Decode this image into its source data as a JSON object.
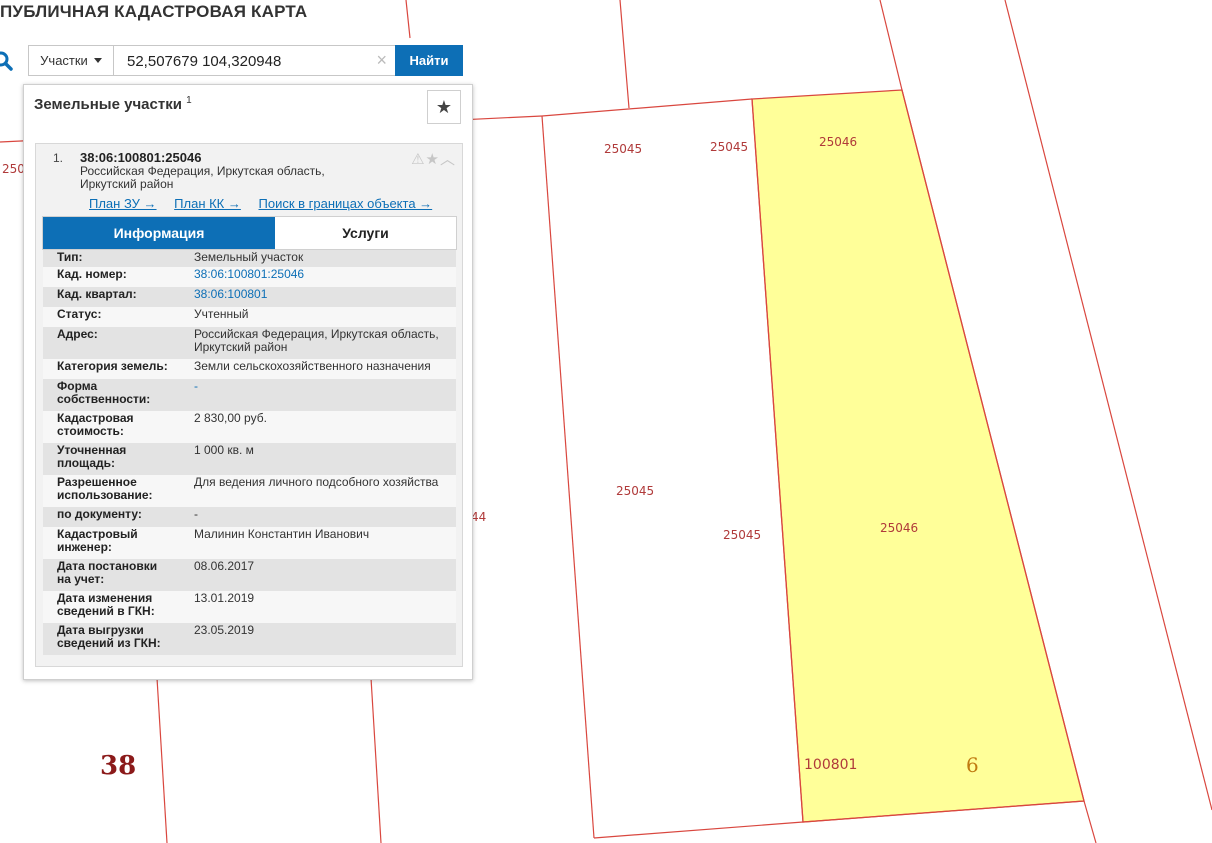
{
  "app_title": "ПУБЛИЧНАЯ КАДАСТРОВАЯ КАРТА",
  "search": {
    "type_label": "Участки",
    "query": "52,507679 104,320948",
    "clear_glyph": "×",
    "find_label": "Найти"
  },
  "panel": {
    "title": "Земельные участки",
    "count": "1",
    "favorite_glyph": "★"
  },
  "result": {
    "index": "1.",
    "cad_number": "38:06:100801:25046",
    "address_line1": "Российская Федерация, Иркутская область,",
    "address_line2": "Иркутский район",
    "links": {
      "plan_zu": "План ЗУ →",
      "plan_kk": "План КК →",
      "search_bounds": "Поиск в границах объекта →"
    },
    "tabs": {
      "info": "Информация",
      "services": "Услуги"
    },
    "details": [
      {
        "key": "Тип:",
        "value": "Земельный участок"
      },
      {
        "key": "Кад. номер:",
        "value": "38:06:100801:25046"
      },
      {
        "key": "Кад. квартал:",
        "value": "38:06:100801"
      },
      {
        "key": "Статус:",
        "value": "Учтенный"
      },
      {
        "key": "Адрес:",
        "value": "Российская Федерация, Иркутская область, Иркутский район"
      },
      {
        "key": "Категория земель:",
        "value": "Земли сельскохозяйственного назначения"
      },
      {
        "key": "Форма собственности:",
        "value": "-"
      },
      {
        "key": "Кадастровая стоимость:",
        "value": "2 830,00 руб."
      },
      {
        "key": "Уточненная площадь:",
        "value": "1 000 кв. м"
      },
      {
        "key": "Разрешенное использование:",
        "value": "Для ведения личного подсобного хозяйства"
      },
      {
        "key": "по документу:",
        "value": "-"
      },
      {
        "key": "Кадастровый инженер:",
        "value": "Малинин Константин Иванович"
      },
      {
        "key": "Дата постановки на учет:",
        "value": "08.06.2017"
      },
      {
        "key": "Дата изменения сведений в ГКН:",
        "value": "13.01.2019"
      },
      {
        "key": "Дата выгрузки сведений из ГКН:",
        "value": "23.05.2019"
      }
    ]
  },
  "map": {
    "parcel_labels": {
      "a": "25045",
      "b": "25045",
      "c": "25046",
      "d": "25045",
      "e": "25045",
      "f": "25046",
      "g": "250",
      "h": "44"
    },
    "region_number": "38",
    "quarter_number": "100801",
    "district_number": "6",
    "colors": {
      "boundary": "#d9473f",
      "selected_fill": "#ffff99",
      "label": "#b03a3a"
    }
  }
}
